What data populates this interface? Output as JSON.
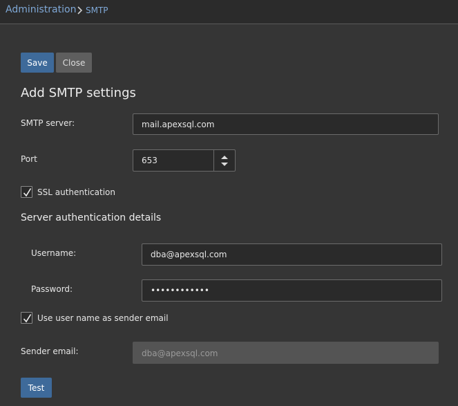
{
  "breadcrumb": {
    "root": "Administration",
    "current": "SMTP"
  },
  "toolbar": {
    "save_label": "Save",
    "close_label": "Close"
  },
  "form": {
    "title": "Add SMTP settings",
    "smtp_server": {
      "label": "SMTP server:",
      "value": "mail.apexsql.com"
    },
    "port": {
      "label": "Port",
      "value": "653"
    },
    "ssl": {
      "label": "SSL authentication",
      "checked": true
    },
    "auth_section_title": "Server authentication details",
    "username": {
      "label": "Username:",
      "value": "dba@apexsql.com"
    },
    "password": {
      "label": "Password:",
      "value": "••••••••••••"
    },
    "use_username": {
      "label": "Use user name as sender email",
      "checked": true
    },
    "sender_email": {
      "label": "Sender email:",
      "value": "dba@apexsql.com"
    },
    "test_label": "Test"
  },
  "colors": {
    "background": "#353535",
    "primary_button": "#3e6a9a",
    "secondary_button": "#5e5e5e",
    "link": "#7fa8d6"
  },
  "icons": {
    "breadcrumb_separator": "chevron-right-icon",
    "stepper_up": "caret-up-icon",
    "stepper_down": "caret-down-icon",
    "checkmark": "checkmark-icon"
  }
}
